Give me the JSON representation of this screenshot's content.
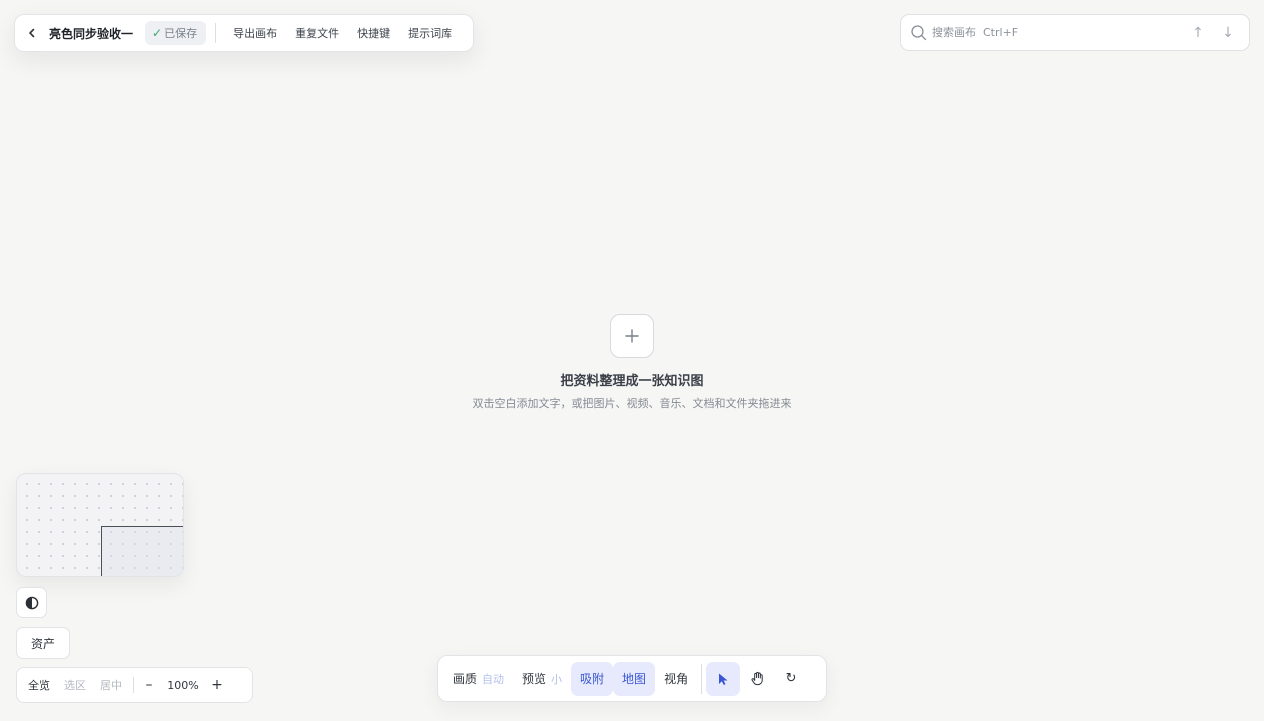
{
  "toolbar": {
    "title": "亮色同步验收一",
    "saved_label": "已保存",
    "saved_check": "✓",
    "links": [
      "导出画布",
      "重复文件",
      "快捷键",
      "提示词库"
    ]
  },
  "search": {
    "placeholder": "搜索画布  Ctrl+F",
    "up_arrow": "↑",
    "down_arrow": "↓"
  },
  "empty_state": {
    "title": "把资料整理成一张知识图",
    "hint": "双击空白添加文字，或把图片、视频、音乐、文档和文件夹拖进来"
  },
  "left_panel": {
    "assets_label": "资产",
    "zoom": {
      "fit_all": "全览",
      "selection": "选区",
      "center": "居中",
      "zoom_out": "–",
      "zoom_level": "100%",
      "zoom_in": "+"
    }
  },
  "bottom_toolbar": {
    "quality_label": "画质",
    "quality_value": "自动",
    "preview_label": "预览",
    "preview_value": "小",
    "snap_label": "吸附",
    "map_label": "地图",
    "view_label": "视角",
    "refresh_glyph": "↻"
  },
  "colors": {
    "accent": "#3a56d4",
    "active_bg": "#e6eafc",
    "saved_check": "#3fa36c"
  }
}
